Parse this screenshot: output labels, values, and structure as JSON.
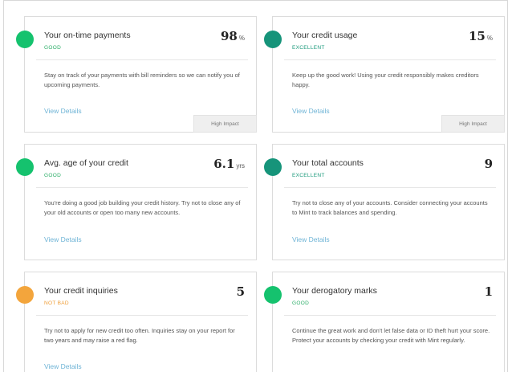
{
  "cards": [
    {
      "title": "Your on-time payments",
      "status": "GOOD",
      "value": "98",
      "unit": "%",
      "description": "Stay on track of your payments with bill reminders so we can notify you of upcoming payments.",
      "link": "View Details",
      "impact": "High Impact",
      "dot_color": "#15c26e"
    },
    {
      "title": "Your credit usage",
      "status": "EXCELLENT",
      "value": "15",
      "unit": "%",
      "description": "Keep up the good work! Using your credit responsibly makes creditors happy.",
      "link": "View Details",
      "impact": "High Impact",
      "dot_color": "#16947a"
    },
    {
      "title": "Avg. age of your credit",
      "status": "GOOD",
      "value": "6.1",
      "unit": "yrs",
      "description": "You're doing a good job building your credit history. Try not to close any of your old accounts or open too many new accounts.",
      "link": "View Details",
      "dot_color": "#15c26e"
    },
    {
      "title": "Your total accounts",
      "status": "EXCELLENT",
      "value": "9",
      "description": "Try not to close any of your accounts. Consider connecting your accounts to Mint to track balances and spending.",
      "link": "View Details",
      "dot_color": "#16947a"
    },
    {
      "title": "Your credit inquiries",
      "status": "NOT BAD",
      "value": "5",
      "description": "Try not to apply for new credit too often. Inquiries stay on your report for two years and may raise a red flag.",
      "link": "View Details",
      "dot_color": "#f3a53c"
    },
    {
      "title": "Your derogatory marks",
      "status": "GOOD",
      "value": "1",
      "description": "Continue the great work and don't let false data or ID theft hurt your score. Protect your accounts by checking your credit with Mint regularly.",
      "link": "View Details",
      "dot_color": "#15c26e"
    }
  ]
}
